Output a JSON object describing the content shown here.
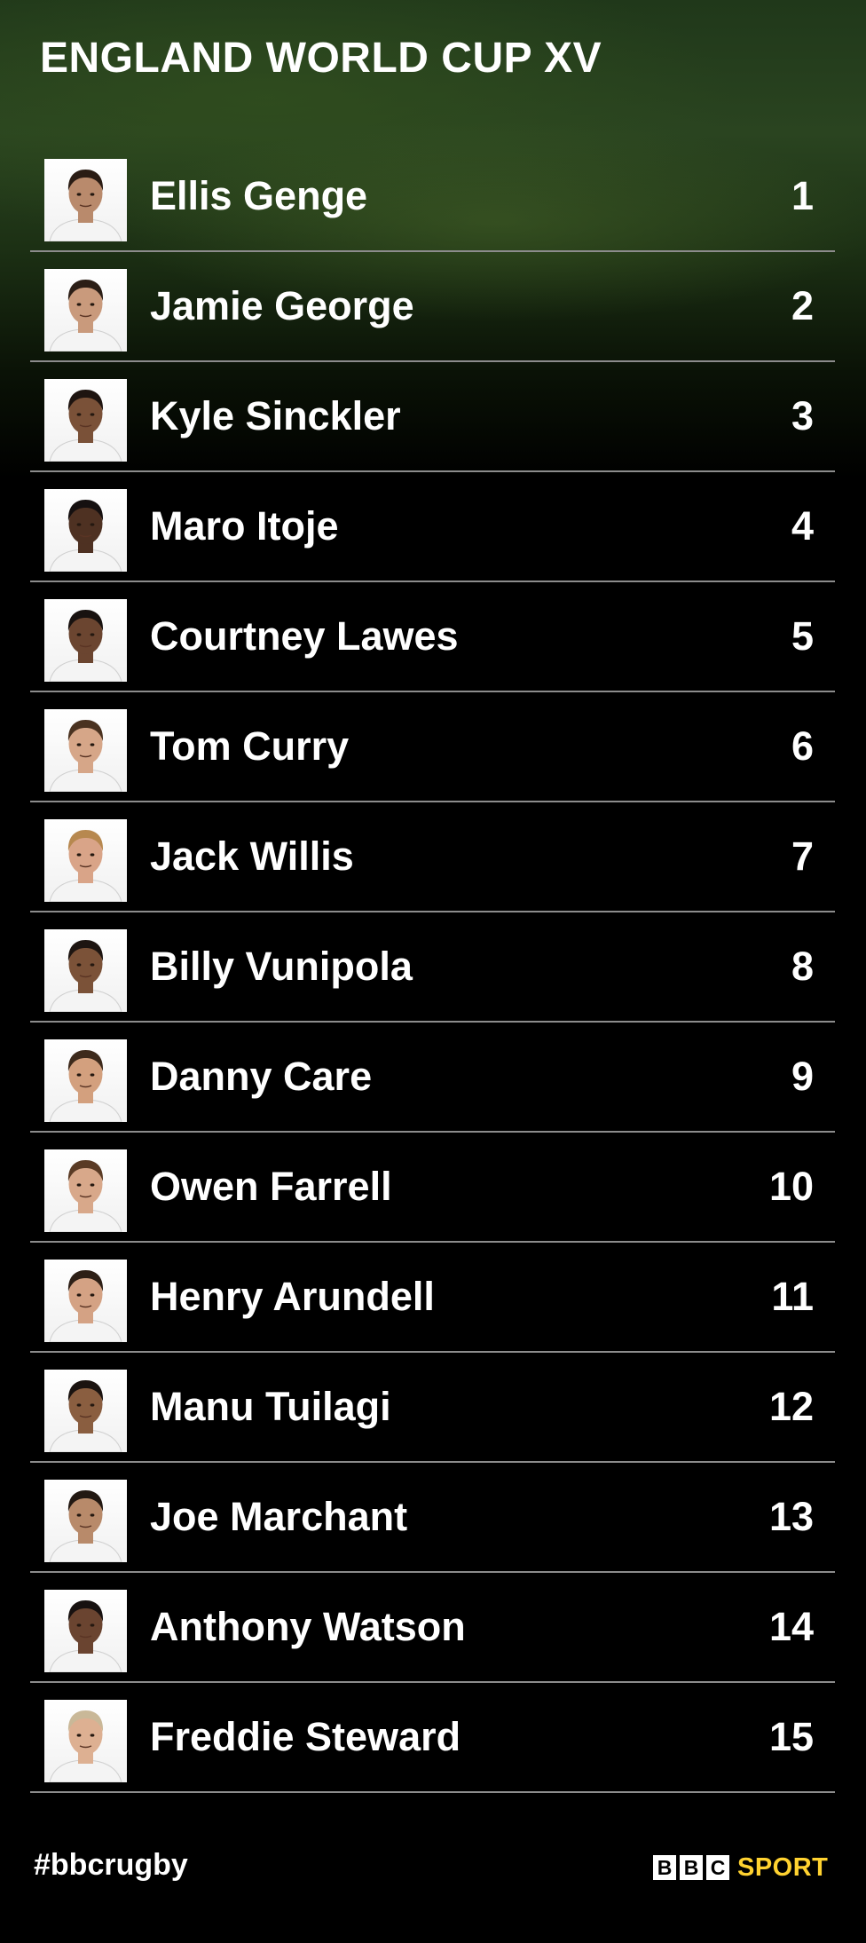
{
  "title": "ENGLAND WORLD CUP XV",
  "players": [
    {
      "name": "Ellis Genge",
      "number": "1",
      "skin": "#b98a6c",
      "hair": "#2a1c14"
    },
    {
      "name": "Jamie George",
      "number": "2",
      "skin": "#c99a7c",
      "hair": "#2b1e16"
    },
    {
      "name": "Kyle Sinckler",
      "number": "3",
      "skin": "#7a5138",
      "hair": "#1e1410"
    },
    {
      "name": "Maro Itoje",
      "number": "4",
      "skin": "#4e3122",
      "hair": "#151010"
    },
    {
      "name": "Courtney Lawes",
      "number": "5",
      "skin": "#6b4530",
      "hair": "#181210"
    },
    {
      "name": "Tom Curry",
      "number": "6",
      "skin": "#d6a688",
      "hair": "#4a3220"
    },
    {
      "name": "Jack Willis",
      "number": "7",
      "skin": "#d9a488",
      "hair": "#b7884f"
    },
    {
      "name": "Billy Vunipola",
      "number": "8",
      "skin": "#7b5238",
      "hair": "#1d1511"
    },
    {
      "name": "Danny Care",
      "number": "9",
      "skin": "#d3a07e",
      "hair": "#3d2a1c"
    },
    {
      "name": "Owen Farrell",
      "number": "10",
      "skin": "#d8a88a",
      "hair": "#5a3b25"
    },
    {
      "name": "Henry Arundell",
      "number": "11",
      "skin": "#d4a284",
      "hair": "#2d1f16"
    },
    {
      "name": "Manu Tuilagi",
      "number": "12",
      "skin": "#8a5e40",
      "hair": "#1a1310"
    },
    {
      "name": "Joe Marchant",
      "number": "13",
      "skin": "#b88a6a",
      "hair": "#221812"
    },
    {
      "name": "Anthony Watson",
      "number": "14",
      "skin": "#6a4430",
      "hair": "#171110"
    },
    {
      "name": "Freddie Steward",
      "number": "15",
      "skin": "#ddb092",
      "hair": "#c9b898"
    }
  ],
  "footer": {
    "hashtag": "#bbcrugby",
    "logo_letters": [
      "B",
      "B",
      "C"
    ],
    "logo_sport": "SPORT"
  },
  "colors": {
    "accent_sport": "#ffd230",
    "divider": "#8c8c8c",
    "background": "#000000"
  }
}
